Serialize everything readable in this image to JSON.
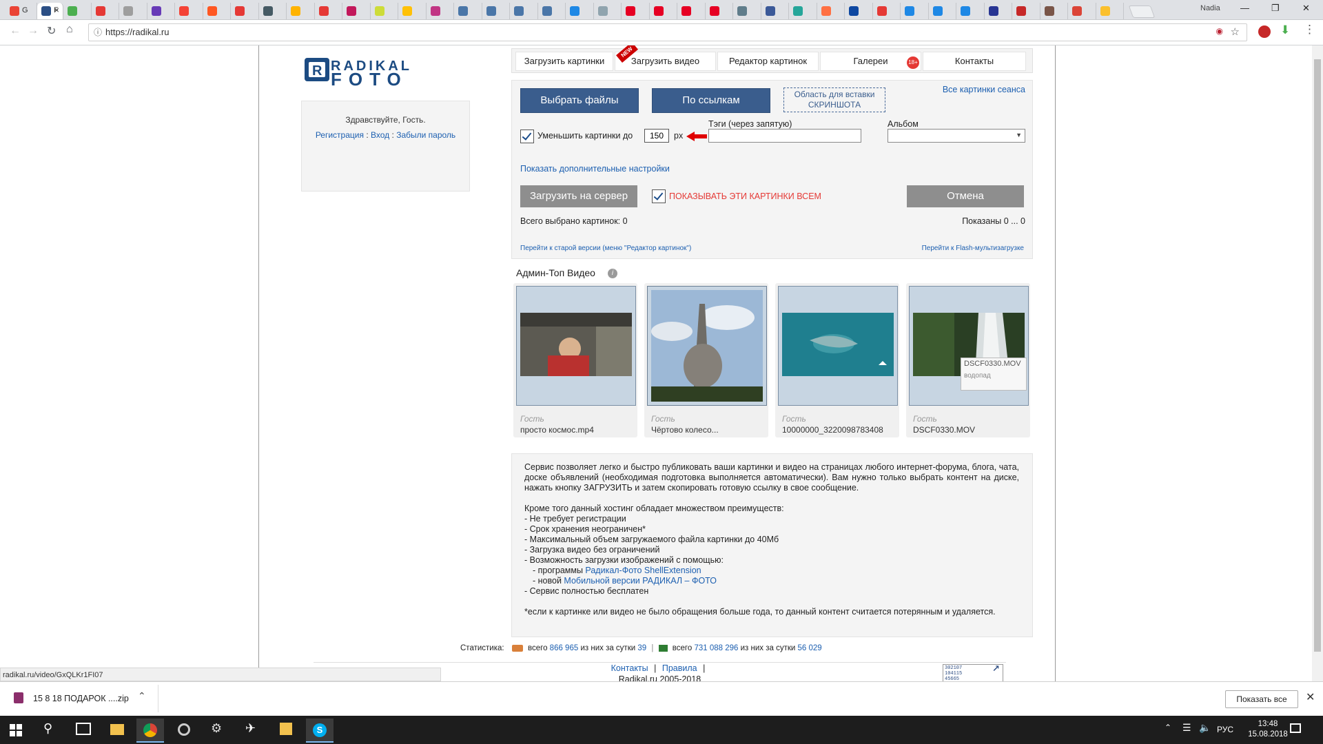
{
  "browser": {
    "tabs": [
      {
        "fav": "#ea4335",
        "label": "G"
      },
      {
        "fav": "#2b4f85",
        "label": "F",
        "active": true
      },
      {
        "fav": "#4caf50",
        "label": ""
      },
      {
        "fav": "#e53935",
        "label": ""
      },
      {
        "fav": "#9e9e9e",
        "label": ""
      },
      {
        "fav": "#673ab7",
        "label": ""
      },
      {
        "fav": "#f44336",
        "label": ""
      },
      {
        "fav": "#ff5722",
        "label": ""
      },
      {
        "fav": "#e53935",
        "label": ""
      },
      {
        "fav": "#455a64",
        "label": ""
      },
      {
        "fav": "#ffb300",
        "label": ""
      },
      {
        "fav": "#e53935",
        "label": ""
      },
      {
        "fav": "#c2185b",
        "label": ""
      },
      {
        "fav": "#cddc39",
        "label": ""
      },
      {
        "fav": "#ffc107",
        "label": ""
      },
      {
        "fav": "#c13584",
        "label": ""
      },
      {
        "fav": "#4a76a8",
        "label": ""
      },
      {
        "fav": "#4a76a8",
        "label": ""
      },
      {
        "fav": "#4a76a8",
        "label": ""
      },
      {
        "fav": "#4a76a8",
        "label": ""
      },
      {
        "fav": "#1e88e5",
        "label": ""
      },
      {
        "fav": "#90a4ae",
        "label": ""
      },
      {
        "fav": "#e60023",
        "label": ""
      },
      {
        "fav": "#e60023",
        "label": ""
      },
      {
        "fav": "#e60023",
        "label": ""
      },
      {
        "fav": "#e60023",
        "label": ""
      },
      {
        "fav": "#607d8b",
        "label": ""
      },
      {
        "fav": "#3b5998",
        "label": ""
      },
      {
        "fav": "#26a69a",
        "label": ""
      },
      {
        "fav": "#ff7043",
        "label": ""
      },
      {
        "fav": "#0d47a1",
        "label": ""
      },
      {
        "fav": "#e53935",
        "label": ""
      },
      {
        "fav": "#1e88e5",
        "label": ""
      },
      {
        "fav": "#1e88e5",
        "label": ""
      },
      {
        "fav": "#1e88e5",
        "label": ""
      },
      {
        "fav": "#283593",
        "label": ""
      },
      {
        "fav": "#c62828",
        "label": ""
      },
      {
        "fav": "#795548",
        "label": ""
      },
      {
        "fav": "#db4437",
        "label": ""
      },
      {
        "fav": "#fbc02d",
        "label": ""
      }
    ],
    "profile_name": "Nadia",
    "url": "https://radikal.ru",
    "status_url": "radikal.ru/video/GxQLKr1FI07"
  },
  "nav": {
    "items": [
      "Загрузить картинки",
      "Загрузить видео",
      "Редактор картинок",
      "Галереи",
      "Контакты"
    ],
    "new_badge": "NEW",
    "age_badge": "18+"
  },
  "guest": {
    "greeting": "Здравствуйте, Гость.",
    "register": "Регистрация",
    "login": "Вход",
    "forgot": "Забыли пароль",
    "sep": ":",
    "sep2": ":"
  },
  "upload": {
    "choose_files": "Выбрать файлы",
    "by_links": "По ссылкам",
    "paste_area_l1": "Область для вставки",
    "paste_area_l2": "СКРИНШОТА",
    "all_session": "Все картинки сеанса",
    "reduce_label": "Уменьшить картинки до",
    "reduce_value": "150",
    "reduce_unit": "px",
    "tags_label": "Тэги (через запятую)",
    "album_label": "Альбом",
    "more_settings": "Показать дополнительные настройки",
    "upload_server": "Загрузить на сервер",
    "show_all": "ПОКАЗЫВАТЬ ЭТИ КАРТИНКИ ВСЕМ",
    "cancel": "Отмена",
    "total_selected": "Всего выбрано картинок: 0",
    "shown": "Показаны 0 ... 0",
    "old_version": "Перейти к старой версии (меню \"Редактор картинок\")",
    "flash_upload": "Перейти к Flash-мультизагрузке"
  },
  "videos": {
    "title": "Админ-Топ Видео",
    "items": [
      {
        "author": "Гость",
        "name": "просто космос.mp4"
      },
      {
        "author": "Гость",
        "name": "Чёртово колесо..."
      },
      {
        "author": "Гость",
        "name": "10000000_3220098783408"
      },
      {
        "author": "Гость",
        "name": "DSCF0330.MOV"
      }
    ],
    "tooltip_title": "DSCF0330.MOV",
    "tooltip_sub": "водопад"
  },
  "info": {
    "p1": "Сервис позволяет легко и быстро публиковать ваши картинки и видео на страницах любого интернет-форума, блога, чата, доске объявлений (необходимая подготовка выполняется автоматически). Вам нужно только выбрать контент на диске, нажать кнопку ЗАГРУЗИТЬ и затем скопировать готовую ссылку в свое сообщение.",
    "p2": "Кроме того данный хостинг обладает множеством преимуществ:",
    "l1": "- Не требует регистрации",
    "l2": "- Срок хранения неограничен*",
    "l3": "- Максимальный объем загружаемого файла картинки до 40Мб",
    "l4": "- Загрузка видео без ограничений",
    "l5": "- Возможность загрузки изображений с помощью:",
    "l6a": "- программы ",
    "l6b": "Радикал-Фото ShellExtension",
    "l7a": "- новой ",
    "l7b": "Мобильной версии РАДИКАЛ – ФОТО",
    "l8": "- Сервис полностью бесплатен",
    "p3": "*если к картинке или видео не было обращения больше года, то данный контент считается потерянным и удаляется."
  },
  "stats": {
    "label": "Статистика:",
    "total1": "всего",
    "v1": "866 965",
    "day1": "из них за сутки",
    "d1": "39",
    "total2": "всего",
    "v2": "731 088 296",
    "day2": "из них за сутки",
    "d2": "56 029"
  },
  "footer": {
    "contacts": "Контакты",
    "rules": "Правила",
    "copyright": "Radikal.ru 2005-2018",
    "counter": [
      "302107",
      "104115",
      "45665"
    ]
  },
  "download": {
    "file": "15 8 18 ПОДАРОК ....zip",
    "show_all": "Показать все"
  },
  "taskbar": {
    "lang": "РУС",
    "time": "13:48",
    "date": "15.08.2018"
  }
}
